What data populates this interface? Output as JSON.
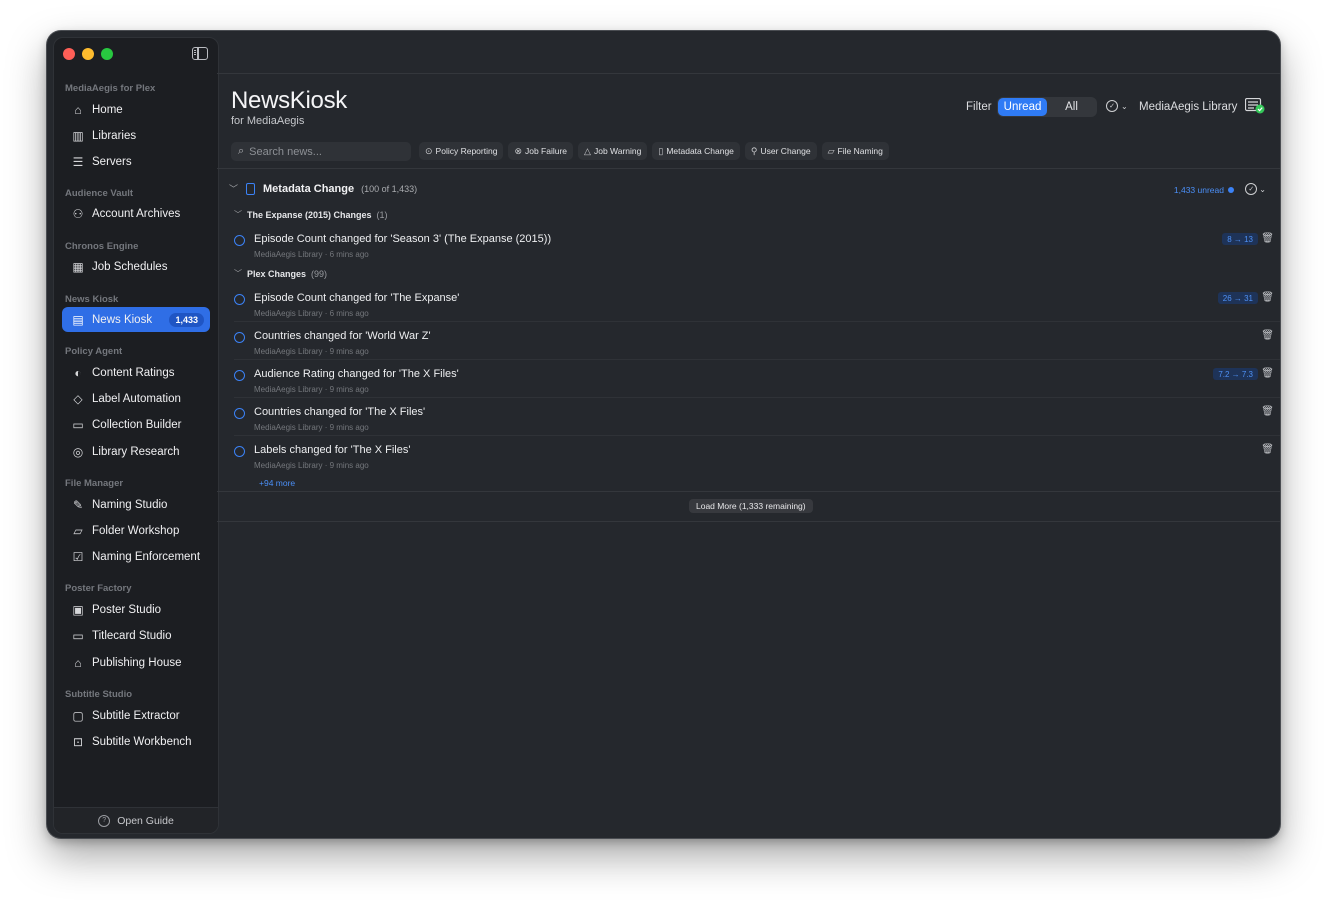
{
  "sidebar": {
    "sections": [
      {
        "label": "MediaAegis for Plex",
        "items": [
          {
            "label": "Home",
            "icon": "home-icon"
          },
          {
            "label": "Libraries",
            "icon": "books-icon"
          },
          {
            "label": "Servers",
            "icon": "server-icon"
          }
        ]
      },
      {
        "label": "Audience Vault",
        "items": [
          {
            "label": "Account Archives",
            "icon": "users-icon"
          }
        ]
      },
      {
        "label": "Chronos Engine",
        "items": [
          {
            "label": "Job Schedules",
            "icon": "calendar-clock-icon"
          }
        ]
      },
      {
        "label": "News Kiosk",
        "items": [
          {
            "label": "News Kiosk",
            "icon": "newspaper-icon",
            "badge": "1,433",
            "active": true
          }
        ]
      },
      {
        "label": "Policy Agent",
        "items": [
          {
            "label": "Content Ratings",
            "icon": "shield-icon"
          },
          {
            "label": "Label Automation",
            "icon": "tag-icon"
          },
          {
            "label": "Collection Builder",
            "icon": "stack-icon"
          },
          {
            "label": "Library Research",
            "icon": "research-icon"
          }
        ]
      },
      {
        "label": "File Manager",
        "items": [
          {
            "label": "Naming Studio",
            "icon": "document-edit-icon"
          },
          {
            "label": "Folder Workshop",
            "icon": "folder-icon"
          },
          {
            "label": "Naming Enforcement",
            "icon": "checklist-icon"
          }
        ]
      },
      {
        "label": "Poster Factory",
        "items": [
          {
            "label": "Poster Studio",
            "icon": "image-icon"
          },
          {
            "label": "Titlecard Studio",
            "icon": "display-icon"
          },
          {
            "label": "Publishing House",
            "icon": "building-icon"
          }
        ]
      },
      {
        "label": "Subtitle Studio",
        "items": [
          {
            "label": "Subtitle Extractor",
            "icon": "caption-icon"
          },
          {
            "label": "Subtitle Workbench",
            "icon": "tray-icon"
          }
        ]
      }
    ],
    "footer_label": "Open Guide"
  },
  "header": {
    "title": "NewsKiosk",
    "subtitle": "for MediaAegis",
    "filter_label": "Filter",
    "filter_options": [
      "Unread",
      "All"
    ],
    "filter_selected": "Unread",
    "library_label": "MediaAegis Library"
  },
  "search": {
    "placeholder": "Search news..."
  },
  "chips": [
    {
      "label": "Policy Reporting",
      "icon": "policy-icon"
    },
    {
      "label": "Job Failure",
      "icon": "x-circle-icon"
    },
    {
      "label": "Job Warning",
      "icon": "warning-icon"
    },
    {
      "label": "Metadata Change",
      "icon": "document-icon"
    },
    {
      "label": "User Change",
      "icon": "user-icon"
    },
    {
      "label": "File Naming",
      "icon": "folder-icon"
    }
  ],
  "group": {
    "title": "Metadata Change",
    "count": "(100 of 1,433)",
    "unread": "1,433 unread"
  },
  "subgroups": [
    {
      "title": "The Expanse (2015) Changes",
      "count": "(1)"
    },
    {
      "title": "Plex Changes",
      "count": "(99)"
    }
  ],
  "items": [
    {
      "text": "Episode Count changed for 'Season 3' (The Expanse (2015))",
      "meta": "MediaAegis Library · 6 mins ago",
      "change": "8 → 13"
    },
    {
      "text": "Episode Count changed for 'The Expanse'",
      "meta": "MediaAegis Library · 6 mins ago",
      "change": "26 → 31"
    },
    {
      "text": "Countries changed for 'World War Z'",
      "meta": "MediaAegis Library · 9 mins ago",
      "change": ""
    },
    {
      "text": "Audience Rating changed for 'The X Files'",
      "meta": "MediaAegis Library · 9 mins ago",
      "change": "7.2 → 7.3"
    },
    {
      "text": "Countries changed for 'The X Files'",
      "meta": "MediaAegis Library · 9 mins ago",
      "change": ""
    },
    {
      "text": "Labels changed for 'The X Files'",
      "meta": "MediaAegis Library · 9 mins ago",
      "change": ""
    }
  ],
  "more_label": "+94 more",
  "load_more_label": "Load More (1,333 remaining)",
  "colors": {
    "accent": "#2f7bf5",
    "window_bg": "#25282d",
    "sidebar_bg": "#1c1e22"
  }
}
